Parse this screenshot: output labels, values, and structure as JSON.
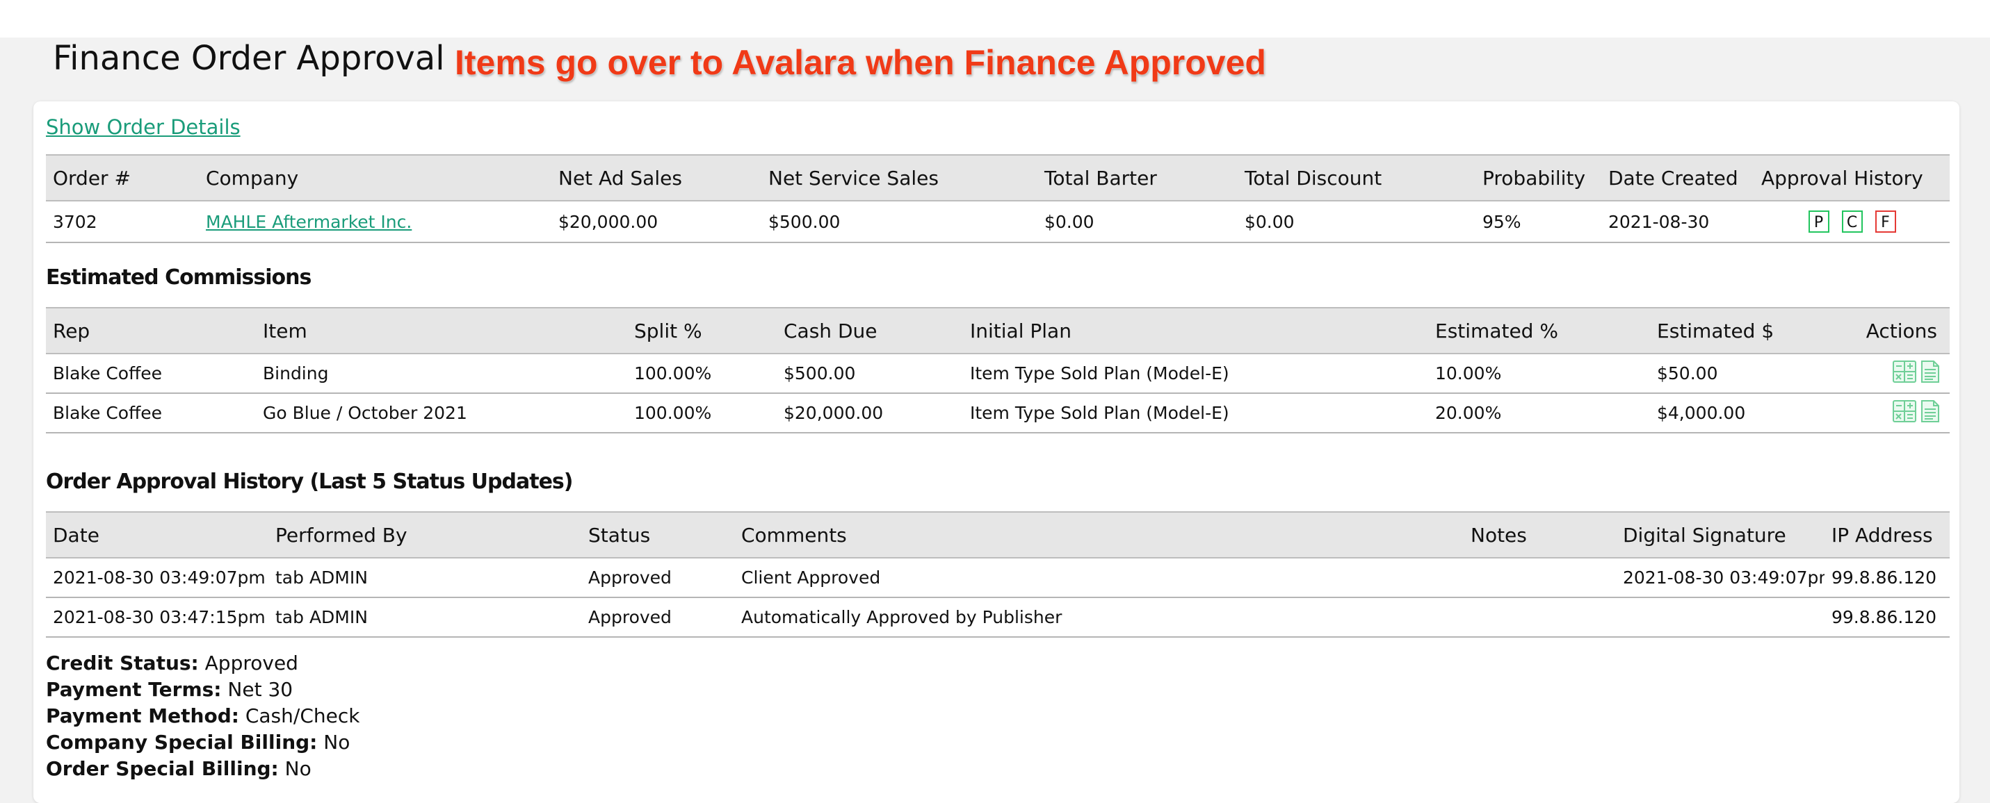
{
  "page": {
    "title": "Finance Order Approval",
    "annotation": "Items go over to Avalara when Finance Approved",
    "show_details_link": "Show Order Details"
  },
  "order_table": {
    "headers": [
      "Order #",
      "Company",
      "Net Ad Sales",
      "Net Service Sales",
      "Total Barter",
      "Total Discount",
      "Probability",
      "Date Created",
      "Approval History"
    ],
    "row": {
      "order_no": "3702",
      "company": "MAHLE Aftermarket Inc.",
      "net_ad_sales": "$20,000.00",
      "net_service_sales": "$500.00",
      "total_barter": "$0.00",
      "total_discount": "$0.00",
      "probability": "95%",
      "date_created": "2021-08-30",
      "approval_badges": [
        "P",
        "C",
        "F"
      ]
    }
  },
  "commissions": {
    "title": "Estimated Commissions",
    "headers": [
      "Rep",
      "Item",
      "Split %",
      "Cash Due",
      "Initial Plan",
      "Estimated %",
      "Estimated $",
      "Actions"
    ],
    "rows": [
      {
        "rep": "Blake Coffee",
        "item": "Binding",
        "split": "100.00%",
        "cash_due": "$500.00",
        "plan": "Item Type Sold Plan (Model-E)",
        "est_pct": "10.00%",
        "est_amt": "$50.00"
      },
      {
        "rep": "Blake Coffee",
        "item": "Go Blue / October 2021",
        "split": "100.00%",
        "cash_due": "$20,000.00",
        "plan": "Item Type Sold Plan (Model-E)",
        "est_pct": "20.00%",
        "est_amt": "$4,000.00"
      }
    ]
  },
  "history": {
    "title": "Order Approval History (Last 5 Status Updates)",
    "headers": [
      "Date",
      "Performed By",
      "Status",
      "Comments",
      "Notes",
      "Digital Signature",
      "IP Address"
    ],
    "rows": [
      {
        "date": "2021-08-30 03:49:07pm",
        "by": "tab ADMIN",
        "status": "Approved",
        "comments": "Client Approved",
        "notes": "",
        "signature": "2021-08-30 03:49:07pm",
        "ip": "99.8.86.120"
      },
      {
        "date": "2021-08-30 03:47:15pm",
        "by": "tab ADMIN",
        "status": "Approved",
        "comments": "Automatically Approved by Publisher",
        "notes": "",
        "signature": "",
        "ip": "99.8.86.120"
      }
    ]
  },
  "summary": {
    "credit_status_label": "Credit Status:",
    "credit_status": "Approved",
    "payment_terms_label": "Payment Terms:",
    "payment_terms": "Net 30",
    "payment_method_label": "Payment Method:",
    "payment_method": "Cash/Check",
    "company_special_billing_label": "Company Special Billing:",
    "company_special_billing": "No",
    "order_special_billing_label": "Order Special Billing:",
    "order_special_billing": "No"
  },
  "colors": {
    "link": "#1a9c7a",
    "annotation": "#f03a17",
    "badge_green": "#22c55e",
    "badge_red": "#e53935",
    "header_bg": "#e6e6e6"
  },
  "icons": [
    "calculator-icon",
    "document-icon"
  ]
}
